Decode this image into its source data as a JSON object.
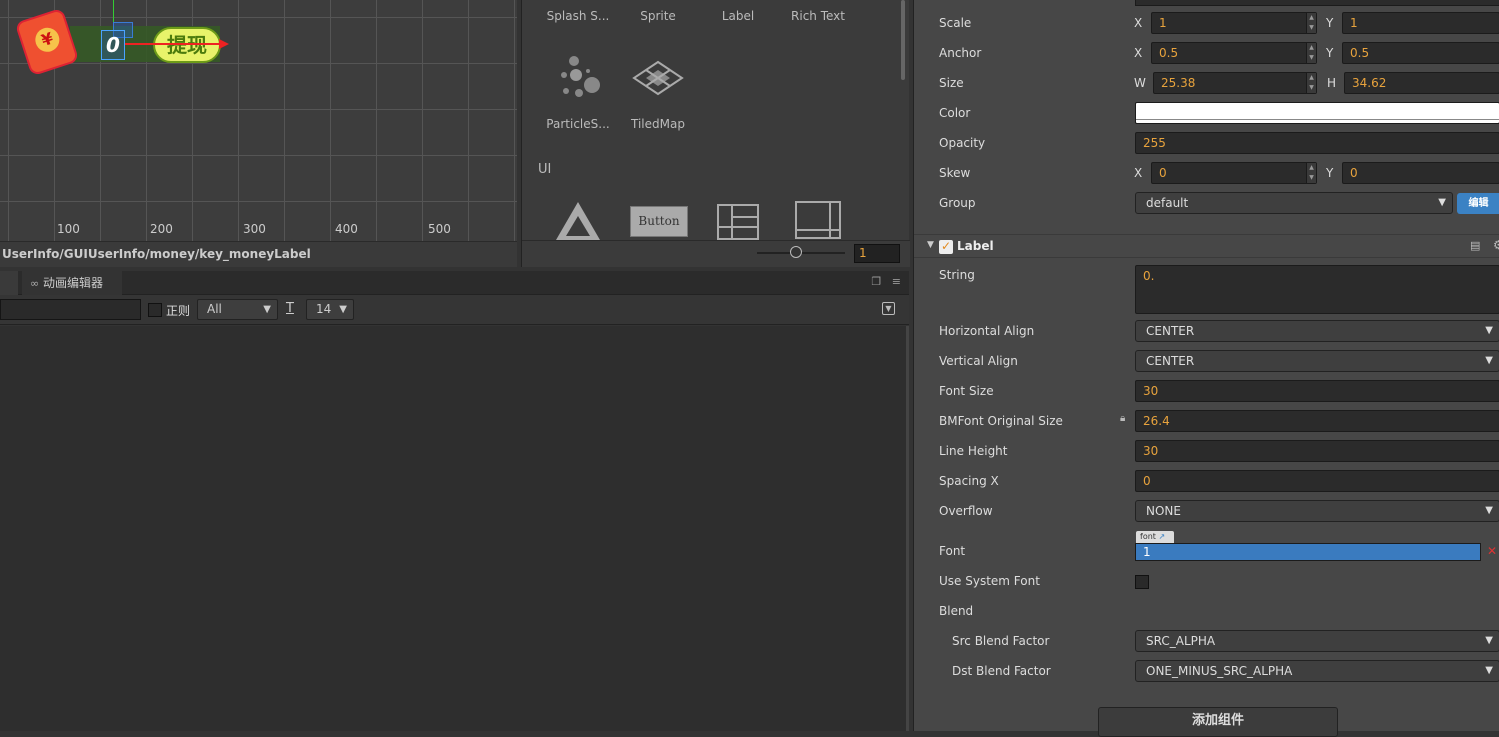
{
  "scene": {
    "axis_labels": [
      "100",
      "200",
      "300",
      "400",
      "500"
    ],
    "red_packet_symbol": "¥",
    "selected_label_text": "0",
    "withdraw_button_text": "提现",
    "node_path": "UserInfo/GUIUserInfo/money/key_moneyLabel"
  },
  "library": {
    "row1": [
      "Splash S...",
      "Sprite",
      "Label",
      "Rich Text"
    ],
    "row2": [
      "ParticleS...",
      "TiledMap"
    ],
    "ui_section": "UI",
    "button_preview": "Button",
    "zoom_value": "1"
  },
  "animation_panel": {
    "tab_label": "动画编辑器",
    "regex_label": "正则",
    "filter_value": "All",
    "font_size_value": "14"
  },
  "inspector": {
    "scale": {
      "label": "Scale",
      "x": "1",
      "y": "1"
    },
    "anchor": {
      "label": "Anchor",
      "x": "0.5",
      "y": "0.5"
    },
    "size": {
      "label": "Size",
      "w": "25.38",
      "h": "34.62"
    },
    "color_label": "Color",
    "opacity": {
      "label": "Opacity",
      "value": "255"
    },
    "skew": {
      "label": "Skew",
      "x": "0",
      "y": "0"
    },
    "group": {
      "label": "Group",
      "value": "default",
      "edit_button": "编辑"
    },
    "axis": {
      "x": "X",
      "y": "Y",
      "w": "W",
      "h": "H"
    },
    "component_title": "Label",
    "string": {
      "label": "String",
      "value": "0."
    },
    "horizontal_align": {
      "label": "Horizontal Align",
      "value": "CENTER"
    },
    "vertical_align": {
      "label": "Vertical Align",
      "value": "CENTER"
    },
    "font_size": {
      "label": "Font Size",
      "value": "30"
    },
    "bmfont_original_size": {
      "label": "BMFont Original Size",
      "value": "26.4"
    },
    "line_height": {
      "label": "Line Height",
      "value": "30"
    },
    "spacing_x": {
      "label": "Spacing X",
      "value": "0"
    },
    "overflow": {
      "label": "Overflow",
      "value": "NONE"
    },
    "font": {
      "label": "Font",
      "tag": "font",
      "value": "1"
    },
    "use_system_font": {
      "label": "Use System Font"
    },
    "blend_label": "Blend",
    "src_blend": {
      "label": "Src Blend Factor",
      "value": "SRC_ALPHA"
    },
    "dst_blend": {
      "label": "Dst Blend Factor",
      "value": "ONE_MINUS_SRC_ALPHA"
    },
    "add_component_button": "添加组件"
  },
  "colors": {
    "accent": "#e8a33d",
    "selection": "#3a7bbf",
    "edit_button": "#3b82c4"
  }
}
